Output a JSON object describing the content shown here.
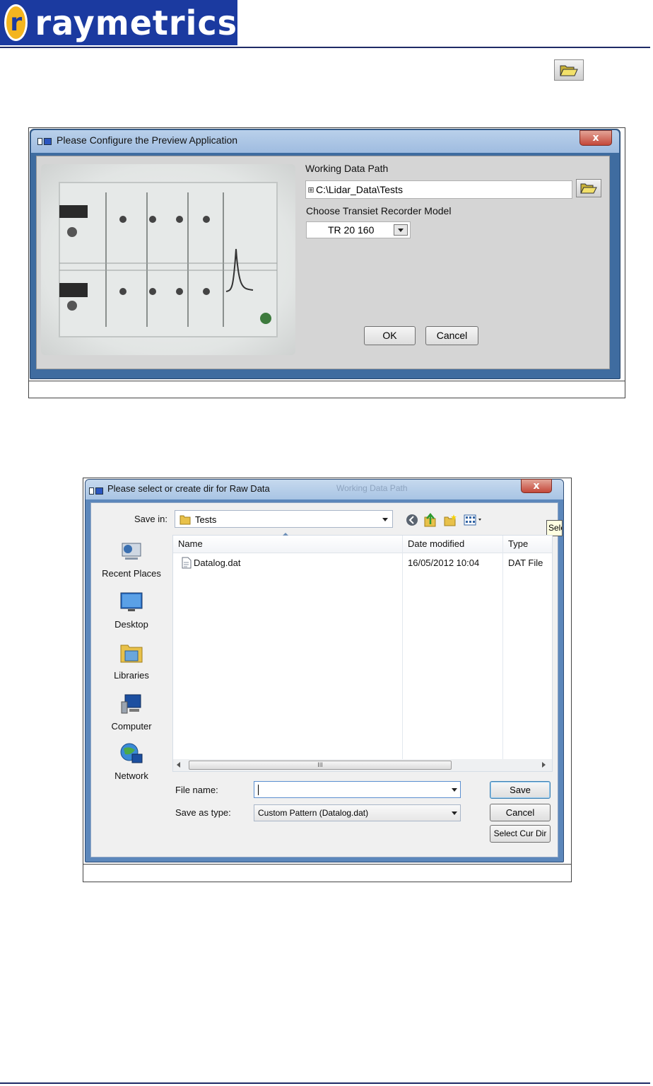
{
  "header": {
    "logo_text": "raymetrics",
    "logo_mark": "r",
    "brand_color": "#1b3aa0",
    "toolbar_icon": "folder-open-icon"
  },
  "config_dialog": {
    "title": "Please Configure the Preview Application",
    "close_label": "x",
    "working_path_label": "Working Data Path",
    "working_path_value": "C:\\Lidar_Data\\Tests",
    "recorder_label": "Choose Transiet Recorder Model",
    "recorder_value": "TR 20 160",
    "ok_label": "OK",
    "cancel_label": "Cancel"
  },
  "save_dialog": {
    "title": "Please select or create dir for Raw Data",
    "ghost_title": "Working Data Path",
    "close_label": "x",
    "save_in_label": "Save in:",
    "save_in_value": "Tests",
    "tooltip": "Sele",
    "places": [
      {
        "label": "Recent Places",
        "icon": "recent-places-icon"
      },
      {
        "label": "Desktop",
        "icon": "desktop-icon"
      },
      {
        "label": "Libraries",
        "icon": "libraries-icon"
      },
      {
        "label": "Computer",
        "icon": "computer-icon"
      },
      {
        "label": "Network",
        "icon": "network-icon"
      }
    ],
    "columns": [
      "Name",
      "Date modified",
      "Type"
    ],
    "files": [
      {
        "name": "Datalog.dat",
        "modified": "16/05/2012 10:04",
        "type": "DAT File"
      }
    ],
    "scrollbar_grip": "III",
    "file_name_label": "File name:",
    "file_name_value": "",
    "save_type_label": "Save as type:",
    "save_type_value": "Custom Pattern (Datalog.dat)",
    "save_label": "Save",
    "cancel_label": "Cancel",
    "select_dir_label": "Select Cur Dir"
  }
}
